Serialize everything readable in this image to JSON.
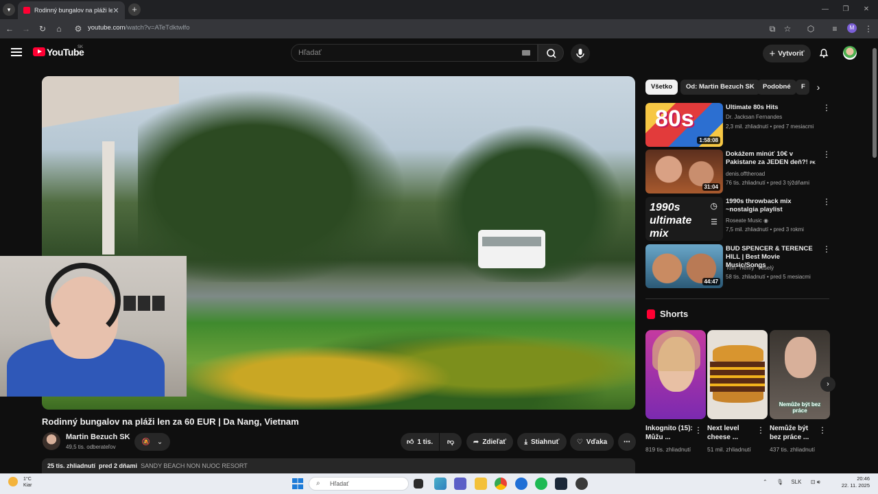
{
  "browser": {
    "tab_title": "Rodinný bungalov na pláži len ...",
    "url_host": "youtube.com",
    "url_path": "/watch?v=ATeTdktwlfo"
  },
  "header": {
    "logo_text": "YouTube",
    "logo_country": "SK",
    "search_placeholder": "Hľadať",
    "create_label": "Vytvoriť"
  },
  "video": {
    "title": "Rodinný bungalov na pláži len za 60 EUR | Da Nang, Vietnam",
    "channel": "Martin Bezuch SK",
    "subscribers": "49,5 tis. odberateľov",
    "like_count": "1 tis.",
    "share_label": "Zdieľať",
    "download_label": "Stiahnuť",
    "thanks_label": "Vďaka",
    "views": "25 tis. zhliadnutí",
    "age": "pred 2 dňami",
    "location_tag": "SANDY BEACH NON NUOC RESORT"
  },
  "chips": [
    "Všetko",
    "Od: Martin Bezuch SK",
    "Podobné",
    "F"
  ],
  "recommendations": [
    {
      "title": "Ultimate 80s Hits",
      "channel": "Dr. Jacksan Fernandes",
      "meta": "2,3 mil. zhliadnutí • pred 7 mesiacmi",
      "duration": "1:58:08",
      "thumb_text": "80s"
    },
    {
      "title": "Dokážem minúť 10€ v Pakistane za JEDEN deň?!",
      "title_suffix": "PK",
      "channel": "denis.offtheroad",
      "meta": "76 tis. zhliadnutí • pred 3 týždňami",
      "duration": "31:04"
    },
    {
      "title": "1990s throwback mix ~nostalgia playlist",
      "channel": "Roseate Music",
      "meta": "7,5 mil. zhliadnutí • pred 3 rokmi",
      "duration": "",
      "thumb_text": "1990s ultimate mix"
    },
    {
      "title": "BUD SPENCER & TERENCE HILL | Best Movie Music/Songs",
      "channel": "Tom \"Henry\" Veselý",
      "meta": "58 tis. zhliadnutí • pred 5 mesiacmi",
      "duration": "44:47"
    }
  ],
  "shorts": {
    "heading": "Shorts",
    "items": [
      {
        "title": "Inkognito (15): Můžu ...",
        "views": "819 tis. zhliadnutí"
      },
      {
        "title": "Next level cheese ...",
        "views": "51 mil. zhliadnutí"
      },
      {
        "title": "Nemůže být bez práce ...",
        "views": "437 tis. zhliadnutí",
        "overlay": "Nemůže být bez práce"
      }
    ]
  },
  "taskbar": {
    "temp": "1°C",
    "weather_desc": "Kiar",
    "search_placeholder": "Hľadať",
    "lang": "SLK",
    "time": "20:46",
    "date": "22. 11. 2025"
  },
  "colors": {
    "accent": "#ff0033",
    "bg": "#0f0f0f",
    "chip": "#272727"
  }
}
